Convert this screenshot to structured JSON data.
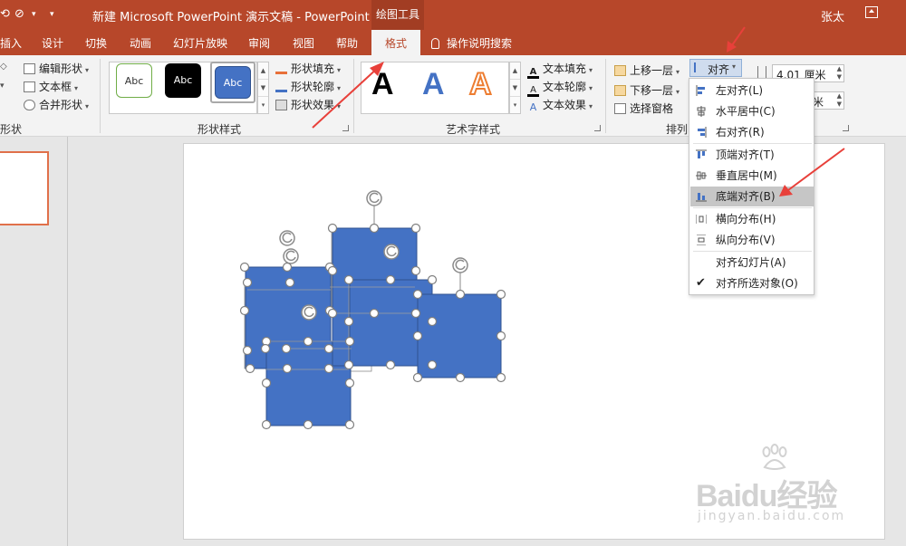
{
  "titlebar": {
    "title": "新建 Microsoft PowerPoint 演示文稿  -  PowerPoint",
    "tool_context": "绘图工具",
    "user": "张太"
  },
  "tabs": {
    "items": [
      "插入",
      "设计",
      "切换",
      "动画",
      "幻灯片放映",
      "审阅",
      "视图",
      "帮助"
    ],
    "active": "格式",
    "tell_me": "操作说明搜索"
  },
  "ribbon": {
    "insert_shapes": {
      "edit_shape": "编辑形状",
      "text_box": "文本框",
      "merge_shapes": "合并形状",
      "label_fragment": "形状"
    },
    "shape_styles": {
      "samples": [
        "Abc",
        "Abc",
        "Abc"
      ],
      "fill": "形状填充",
      "outline": "形状轮廓",
      "effects": "形状效果",
      "label": "形状样式"
    },
    "wordart": {
      "samples": [
        "A",
        "A",
        "A"
      ],
      "text_fill": "文本填充",
      "text_outline": "文本轮廓",
      "text_effects": "文本效果",
      "label": "艺术字样式"
    },
    "arrange": {
      "bring_forward": "上移一层",
      "send_backward": "下移一层",
      "selection_pane": "选择窗格",
      "align": "对齐",
      "label": "排列"
    },
    "size": {
      "height": "4.01 厘米",
      "width_fragment": "米"
    }
  },
  "align_menu": {
    "items": [
      {
        "label": "左对齐(L)",
        "icon": "align-left-icon"
      },
      {
        "label": "水平居中(C)",
        "icon": "align-center-icon"
      },
      {
        "label": "右对齐(R)",
        "icon": "align-right-icon"
      },
      {
        "label": "顶端对齐(T)",
        "icon": "align-top-icon"
      },
      {
        "label": "垂直居中(M)",
        "icon": "align-middle-icon"
      },
      {
        "label": "底端对齐(B)",
        "icon": "align-bottom-icon",
        "highlighted": true
      },
      {
        "label": "横向分布(H)",
        "icon": "distribute-horizontal-icon"
      },
      {
        "label": "纵向分布(V)",
        "icon": "distribute-vertical-icon"
      },
      {
        "label": "对齐幻灯片(A)",
        "icon": ""
      },
      {
        "label": "对齐所选对象(O)",
        "icon": "checkmark-icon",
        "checked": true
      }
    ]
  },
  "colors": {
    "brand": "#b7472a",
    "shape_fill": "#4472c4",
    "annotation_arrow": "#e8403a",
    "menu_highlight": "#c6c6c6"
  },
  "watermark": {
    "brand": "Baidu经验",
    "url": "jingyan.baidu.com"
  }
}
